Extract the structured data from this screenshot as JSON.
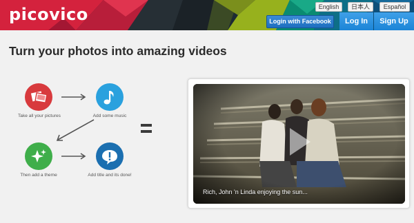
{
  "header": {
    "logo": "picovico",
    "languages": [
      "English",
      "日本人",
      "Español"
    ],
    "facebook_button": "Login with Facebook",
    "login_button": "Log In",
    "signup_button": "Sign Up"
  },
  "main": {
    "headline": "Turn your photos into amazing videos",
    "steps": [
      {
        "label": "Take all your pictures",
        "icon": "photos-icon",
        "color": "#d83a3d"
      },
      {
        "label": "Add some music",
        "icon": "music-note-icon",
        "color": "#2aa1de"
      },
      {
        "label": "Then add a theme",
        "icon": "sparkle-icon",
        "color": "#3fae4a"
      },
      {
        "label": "Add title and its done!",
        "icon": "speech-bubble-icon",
        "color": "#1b6fb0"
      }
    ],
    "video": {
      "caption": "Rich, John 'n Linda enjoying the sun..."
    }
  },
  "colors": {
    "accent_blue": "#1a83d6",
    "header_dark": "#1d2a33"
  }
}
